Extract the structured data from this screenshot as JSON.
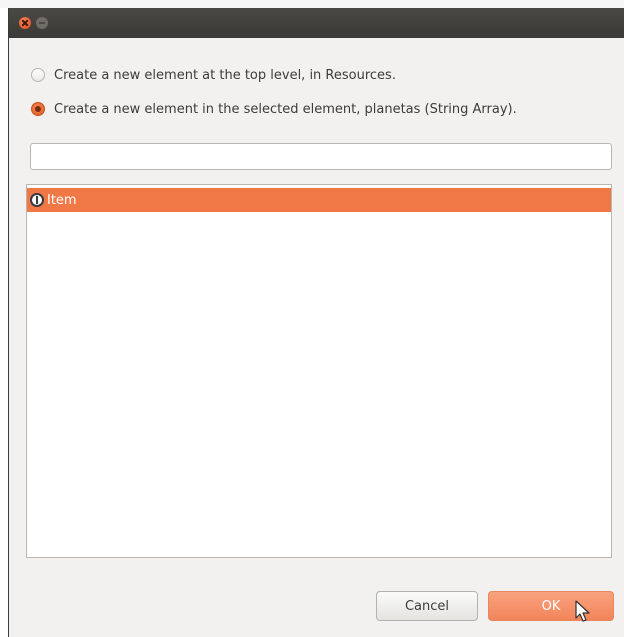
{
  "radio_top_level": {
    "label": "Create a new element at the top level, in Resources.",
    "checked": false
  },
  "radio_selected_element": {
    "label": "Create a new element in the selected element, planetas (String Array).",
    "checked": true
  },
  "filter_input": {
    "value": ""
  },
  "element_list": {
    "items": [
      {
        "label": "Item",
        "icon": "info-icon",
        "selected": true
      }
    ]
  },
  "buttons": {
    "cancel_label": "Cancel",
    "ok_label": "OK"
  },
  "colors": {
    "accent": "#f07746",
    "titlebar": "#3c3b37",
    "dialog_bg": "#f2f1f0"
  }
}
